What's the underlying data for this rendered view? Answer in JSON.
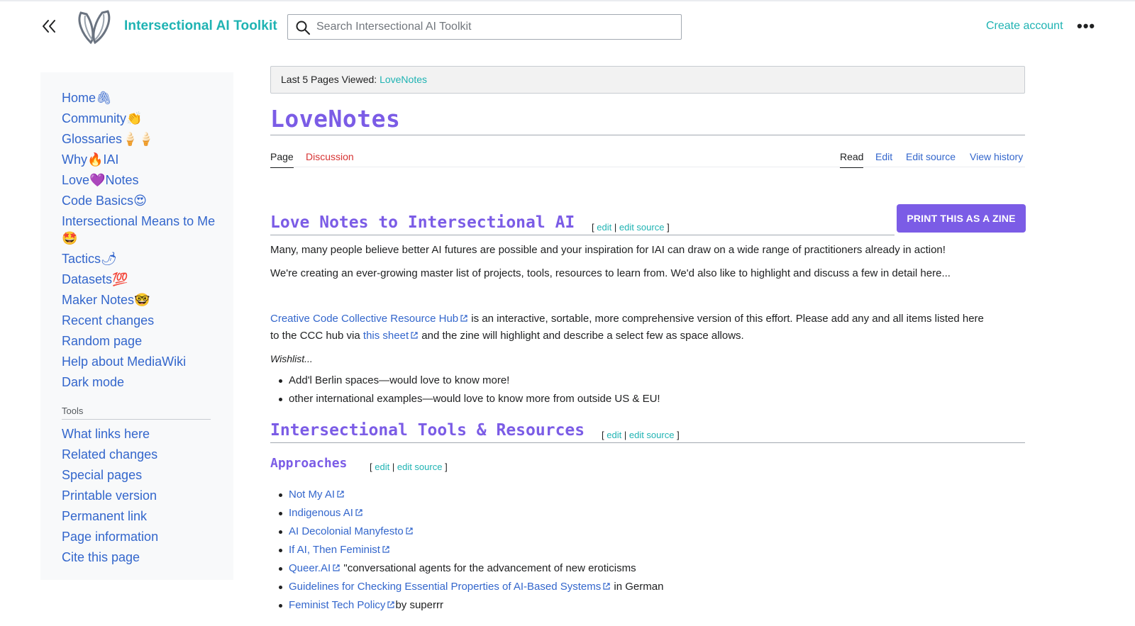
{
  "header": {
    "site_title": "Intersectional AI Toolkit",
    "search_placeholder": "Search Intersectional AI Toolkit",
    "create_account": "Create account",
    "more": "•••"
  },
  "sidebar": {
    "nav": [
      {
        "label": "Home",
        "emoji": "🖇"
      },
      {
        "label": "Community",
        "emoji": "👏"
      },
      {
        "label": "Glossaries",
        "emoji": "🍦🍦"
      },
      {
        "label": "Why",
        "emoji": "🔥",
        "suffix": "IAI"
      },
      {
        "label": "Love",
        "emoji": "💜",
        "suffix": "Notes"
      },
      {
        "label": "Code Basics",
        "emoji": "😍"
      },
      {
        "label": "Intersectional Means to Me",
        "emoji": "🤩"
      },
      {
        "label": "Tactics",
        "emoji": "🌶"
      },
      {
        "label": "Datasets",
        "emoji": "💯"
      },
      {
        "label": "Maker Notes",
        "emoji": "🤓"
      },
      {
        "label": "Recent changes",
        "emoji": ""
      },
      {
        "label": "Random page",
        "emoji": ""
      },
      {
        "label": "Help about MediaWiki",
        "emoji": ""
      },
      {
        "label": "Dark mode",
        "emoji": ""
      }
    ],
    "tools_heading": "Tools",
    "tools": [
      "What links here",
      "Related changes",
      "Special pages",
      "Printable version",
      "Permanent link",
      "Page information",
      "Cite this page"
    ]
  },
  "content": {
    "last_viewed_label": "Last 5 Pages Viewed:",
    "last_viewed_link": "LoveNotes",
    "title": "LoveNotes",
    "tabs_left": [
      "Page",
      "Discussion"
    ],
    "tabs_right": [
      "Read",
      "Edit",
      "Edit source",
      "View history"
    ],
    "zine_button": "PRINT THIS AS A ZINE",
    "edit_open": "[",
    "edit_label": "edit",
    "edit_sep": "|",
    "edit_source_label": "edit source",
    "edit_close": "]",
    "section1": {
      "heading": "Love Notes to Intersectional AI",
      "p1": "Many, many people believe better AI futures are possible and your inspiration for IAI can draw on a wide range of practitioners already in action!",
      "p2": "We're creating an ever-growing master list of projects, tools, resources to learn from. We'd also like to highlight and discuss a few in detail here...",
      "p3_link": "Creative Code Collective Resource Hub",
      "p3_text": " is an interactive, sortable, more comprehensive version of this effort. Please add any and all items listed here",
      "p4_pre": "to the CCC hub via ",
      "p4_link": "this sheet",
      "p4_post": " and the zine will highlight and describe a select few as space allows.",
      "wishlist": "Wishlist...",
      "bullets": [
        "Add'l Berlin spaces—would love to know more!",
        "other international examples—would love to know more from outside US & EU!"
      ]
    },
    "section2": {
      "heading": "Intersectional Tools & Resources",
      "sub_heading": "Approaches",
      "items": [
        {
          "link": "Not My AI",
          "text": ""
        },
        {
          "link": "Indigenous AI",
          "text": ""
        },
        {
          "link": "AI Decolonial Manyfesto",
          "text": ""
        },
        {
          "link": "If AI, Then Feminist",
          "text": ""
        },
        {
          "link": "Queer.AI",
          "text": " \"conversational agents for the advancement of new eroticisms"
        },
        {
          "link": "Guidelines for Checking Essential Properties of AI-Based Systems",
          "text": " in German"
        },
        {
          "link": "Feminist Tech Policy",
          "text": "by superrr"
        }
      ]
    }
  },
  "colors": {
    "teal": "#1fb3b3",
    "purple": "#7b5ce6",
    "link": "#3366cc",
    "red_link": "#d73333"
  }
}
